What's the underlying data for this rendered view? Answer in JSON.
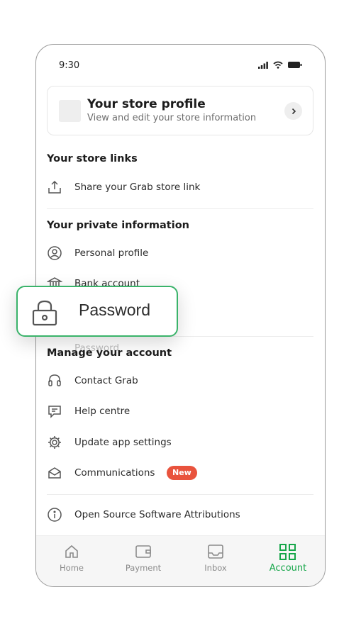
{
  "status_bar": {
    "time": "9:30"
  },
  "store_profile": {
    "title": "Your store profile",
    "subtitle": "View and edit your store information"
  },
  "sections": {
    "store_links": {
      "title": "Your store links",
      "items": [
        {
          "label": "Share your Grab store link",
          "icon": "share-upload-icon"
        }
      ]
    },
    "private_info": {
      "title": "Your private information",
      "items": [
        {
          "label": "Personal profile",
          "icon": "profile-circle-icon"
        },
        {
          "label": "Bank account",
          "icon": "bank-icon"
        },
        {
          "label": "Password",
          "icon": "lock-icon"
        }
      ]
    },
    "manage_account": {
      "title": "Manage your account",
      "items": [
        {
          "label": "Contact Grab",
          "icon": "headset-icon"
        },
        {
          "label": "Help centre",
          "icon": "chat-help-icon"
        },
        {
          "label": "Update app settings",
          "icon": "gear-icon"
        },
        {
          "label": "Communications",
          "icon": "envelope-open-icon",
          "badge": "New"
        }
      ]
    },
    "attributions": {
      "label": "Open Source Software Attributions",
      "icon": "info-icon"
    }
  },
  "callout": {
    "label": "Password",
    "icon": "lock-icon"
  },
  "tabbar": {
    "tabs": [
      {
        "label": "Home",
        "icon": "home-icon"
      },
      {
        "label": "Payment",
        "icon": "wallet-icon"
      },
      {
        "label": "Inbox",
        "icon": "inbox-icon"
      },
      {
        "label": "Account",
        "icon": "grid-icon",
        "active": true
      }
    ]
  },
  "colors": {
    "accent": "#17a64a",
    "badge": "#e9533d",
    "callout_border": "#3ab36a"
  }
}
